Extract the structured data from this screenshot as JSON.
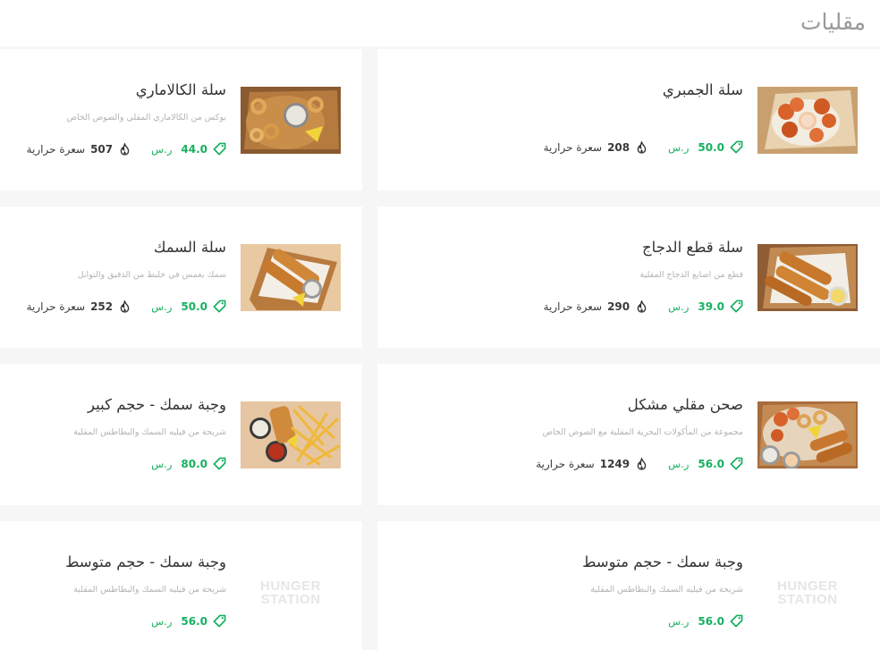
{
  "section": {
    "title": "مقليات"
  },
  "currency": "ر.س",
  "calories_unit": "سعرة حرارية",
  "placeholder_brand": [
    "HUNGER",
    "STATION"
  ],
  "items": [
    {
      "name": "سلة الجمبري",
      "description": "",
      "price": "50.0",
      "calories": "208",
      "image": "shrimp-basket"
    },
    {
      "name": "سلة الكالاماري",
      "description": "بوكس من الكالاماري المقلي والصوص الخاص",
      "price": "44.0",
      "calories": "507",
      "image": "calamari-basket"
    },
    {
      "name": "سلة قطع الدجاج",
      "description": "قطع من اصابع الدجاج المقلية",
      "price": "39.0",
      "calories": "290",
      "image": "chicken-strips-basket"
    },
    {
      "name": "سلة السمك",
      "description": "سمك يغمس في خليط من الدقيق والتوابل",
      "price": "50.0",
      "calories": "252",
      "image": "fish-basket"
    },
    {
      "name": "صحن مقلي مشكل",
      "description": "مجموعة من المأكولات البحرية المقلية مع الصوص الخاص",
      "price": "56.0",
      "calories": "1249",
      "image": "mixed-fried-platter"
    },
    {
      "name": "وجبة سمك - حجم كبير",
      "description": "شريحة من فيليه السمك والبطاطس المقلية",
      "price": "80.0",
      "calories": "",
      "image": "fish-meal-large"
    },
    {
      "name": "وجبة سمك - حجم متوسط",
      "description": "شريحة من فيليه السمك والبطاطس المقلية",
      "price": "56.0",
      "calories": "",
      "image": ""
    },
    {
      "name": "وجبة سمك - حجم متوسط",
      "description": "شريحة من فيليه السمك والبطاطس المقلية",
      "price": "56.0",
      "calories": "",
      "image": ""
    }
  ]
}
